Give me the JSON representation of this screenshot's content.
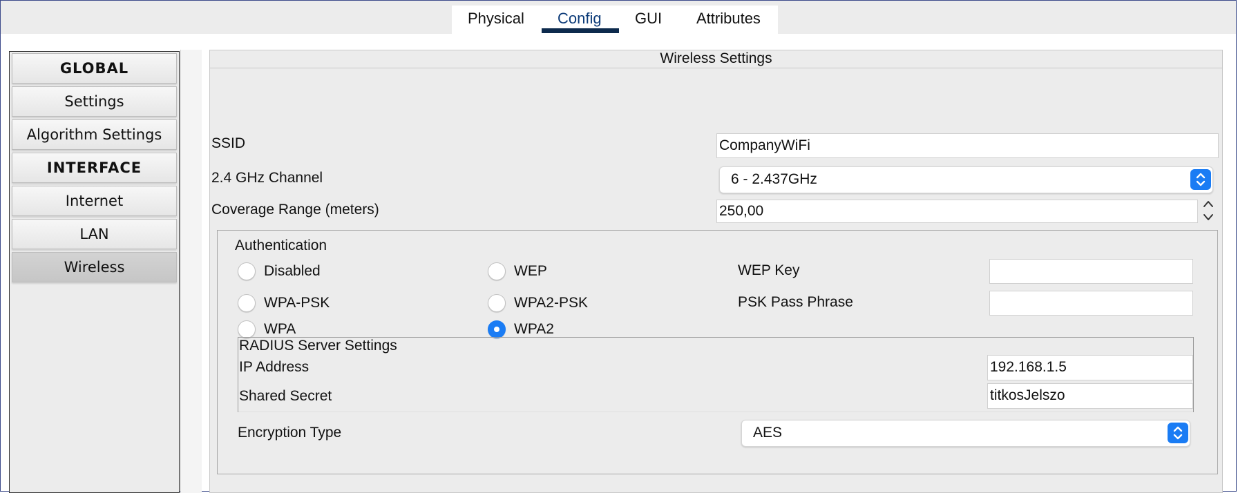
{
  "tabs": [
    {
      "label": "Physical"
    },
    {
      "label": "Config"
    },
    {
      "label": "GUI"
    },
    {
      "label": "Attributes"
    }
  ],
  "active_tab": "Config",
  "sidebar": {
    "items": [
      {
        "label": "GLOBAL",
        "type": "header"
      },
      {
        "label": "Settings",
        "type": "item"
      },
      {
        "label": "Algorithm Settings",
        "type": "item"
      },
      {
        "label": "INTERFACE",
        "type": "header"
      },
      {
        "label": "Internet",
        "type": "item"
      },
      {
        "label": "LAN",
        "type": "item"
      },
      {
        "label": "Wireless",
        "type": "item",
        "selected": true
      }
    ]
  },
  "panel": {
    "title": "Wireless Settings",
    "ssid": {
      "label": "SSID",
      "value": "CompanyWiFi"
    },
    "channel": {
      "label": "2.4 GHz Channel",
      "value": "6 - 2.437GHz"
    },
    "coverage": {
      "label": "Coverage Range (meters)",
      "value": "250,00"
    },
    "auth": {
      "title": "Authentication",
      "options": {
        "disabled": "Disabled",
        "wep": "WEP",
        "wpa_psk": "WPA-PSK",
        "wpa2_psk": "WPA2-PSK",
        "wpa": "WPA",
        "wpa2": "WPA2"
      },
      "selected": "WPA2",
      "wep_key": {
        "label": "WEP Key",
        "value": ""
      },
      "psk_pass": {
        "label": "PSK Pass Phrase",
        "value": ""
      }
    },
    "radius": {
      "title": "RADIUS Server Settings",
      "ip": {
        "label": "IP Address",
        "value": "192.168.1.5"
      },
      "secret": {
        "label": "Shared Secret",
        "value": "titkosJelszo"
      }
    },
    "encryption": {
      "label": "Encryption Type",
      "value": "AES"
    }
  },
  "colors": {
    "accent": "#1a7cf4",
    "tab_underline": "#0d2a4d",
    "active_tab_text": "#0b3a78"
  }
}
